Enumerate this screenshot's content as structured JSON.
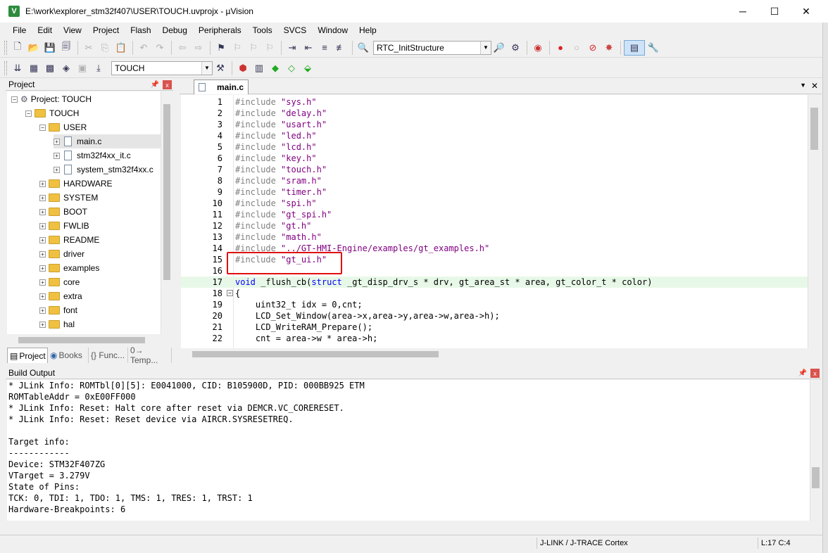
{
  "window": {
    "title": "E:\\work\\explorer_stm32f407\\USER\\TOUCH.uvprojx - µVision",
    "minimize": "─",
    "maximize": "☐",
    "close": "✕"
  },
  "menu": [
    "File",
    "Edit",
    "View",
    "Project",
    "Flash",
    "Debug",
    "Peripherals",
    "Tools",
    "SVCS",
    "Window",
    "Help"
  ],
  "toolbar": {
    "function_combo": "RTC_InitStructure",
    "target_combo": "TOUCH"
  },
  "project_panel": {
    "title": "Project",
    "pin": "📌",
    "close": "x",
    "root": "Project: TOUCH",
    "target": "TOUCH",
    "groups": [
      {
        "name": "USER",
        "expanded": true,
        "files": [
          "main.c",
          "stm32f4xx_it.c",
          "system_stm32f4xx.c"
        ]
      },
      {
        "name": "HARDWARE"
      },
      {
        "name": "SYSTEM"
      },
      {
        "name": "BOOT"
      },
      {
        "name": "FWLIB"
      },
      {
        "name": "README"
      },
      {
        "name": "driver"
      },
      {
        "name": "examples"
      },
      {
        "name": "core"
      },
      {
        "name": "extra"
      },
      {
        "name": "font"
      },
      {
        "name": "hal"
      }
    ],
    "tabs": [
      "Project",
      "Books",
      "{} Func...",
      "0→ Temp..."
    ]
  },
  "editor": {
    "tab": "main.c",
    "lines": [
      {
        "n": "1",
        "pp": "#include ",
        "str": "\"sys.h\""
      },
      {
        "n": "2",
        "pp": "#include ",
        "str": "\"delay.h\""
      },
      {
        "n": "3",
        "pp": "#include ",
        "str": "\"usart.h\""
      },
      {
        "n": "4",
        "pp": "#include ",
        "str": "\"led.h\""
      },
      {
        "n": "5",
        "pp": "#include ",
        "str": "\"lcd.h\""
      },
      {
        "n": "6",
        "pp": "#include ",
        "str": "\"key.h\""
      },
      {
        "n": "7",
        "pp": "#include ",
        "str": "\"touch.h\""
      },
      {
        "n": "8",
        "pp": "#include ",
        "str": "\"sram.h\""
      },
      {
        "n": "9",
        "pp": "#include ",
        "str": "\"timer.h\""
      },
      {
        "n": "10",
        "pp": "#include ",
        "str": "\"spi.h\""
      },
      {
        "n": "11",
        "pp": "#include ",
        "str": "\"gt_spi.h\""
      },
      {
        "n": "12",
        "pp": "#include ",
        "str": "\"gt.h\""
      },
      {
        "n": "13",
        "pp": "#include ",
        "str": "\"math.h\""
      },
      {
        "n": "14",
        "pp": "#include ",
        "str": "\"../GT-HMI-Engine/examples/gt_examples.h\""
      },
      {
        "n": "15",
        "pp": "#include ",
        "str": "\"gt_ui.h\""
      },
      {
        "n": "16",
        "pp": "",
        "str": ""
      },
      {
        "n": "17",
        "kw": "void",
        "rest": " _flush_cb(",
        "kw2": "struct",
        "rest2": " _gt_disp_drv_s * drv, gt_area_st * area, gt_color_t * color)"
      },
      {
        "n": "18",
        "plain": "{"
      },
      {
        "n": "19",
        "plain": "    uint32_t idx = 0,cnt;"
      },
      {
        "n": "20",
        "plain": "    LCD_Set_Window(area->x,area->y,area->w,area->h);"
      },
      {
        "n": "21",
        "plain": "    LCD_WriteRAM_Prepare();"
      },
      {
        "n": "22",
        "plain": "    cnt = area->w * area->h;"
      }
    ]
  },
  "build_output": {
    "title": "Build Output",
    "pin": "📌",
    "close": "x",
    "lines": [
      "* JLink Info: ROMTbl[0][5]: E0041000, CID: B105900D, PID: 000BB925 ETM",
      "ROMTableAddr = 0xE00FF000",
      "* JLink Info: Reset: Halt core after reset via DEMCR.VC_CORERESET.",
      "* JLink Info: Reset: Reset device via AIRCR.SYSRESETREQ.",
      "",
      "Target info:",
      "------------",
      "Device: STM32F407ZG",
      "VTarget = 3.279V",
      "State of Pins:",
      "TCK: 0, TDI: 1, TDO: 1, TMS: 1, TRES: 1, TRST: 1",
      "Hardware-Breakpoints: 6"
    ]
  },
  "status": {
    "debugger": "J-LINK / J-TRACE Cortex",
    "position": "L:17 C:4"
  },
  "colors": {
    "preprocessor": "#808080",
    "string": "#800080",
    "keyword": "#0000ff",
    "current_line": "#e8f8e8",
    "highlight_box": "#e01010"
  }
}
